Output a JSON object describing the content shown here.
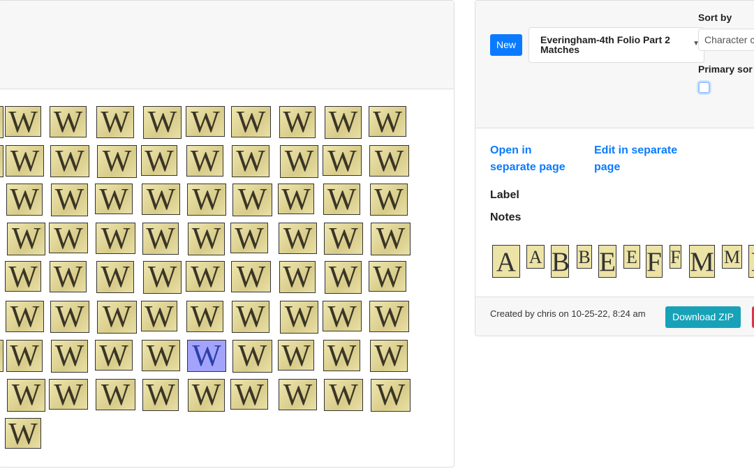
{
  "grid": {
    "glyph": "W",
    "rows": [
      9,
      9,
      9,
      9,
      9,
      9,
      9,
      9,
      1
    ],
    "partial_left_rows": [
      0,
      1,
      6
    ],
    "selected": {
      "row": 6,
      "col": 4
    },
    "selected_color": "#a3a3fb"
  },
  "right": {
    "new_label": "New",
    "collection_select": "Everingham-4th Folio Part 2 Matches",
    "sort_by_label": "Sort by",
    "sort_by_value": "Character c",
    "primary_sort_label": "Primary sor",
    "open_link": "Open in separate page",
    "edit_link": "Edit in separate page",
    "label_heading": "Label",
    "notes_heading": "Notes",
    "samples": [
      "A",
      "A",
      "B",
      "B",
      "E",
      "E",
      "F",
      "F",
      "M",
      "M",
      "I"
    ],
    "created": "Created by chris on 10-25-22, 8:24 am",
    "download_label": "Download ZIP"
  },
  "colors": {
    "primary": "#0a7bff",
    "info": "#17a2b8",
    "danger": "#dc3545"
  }
}
